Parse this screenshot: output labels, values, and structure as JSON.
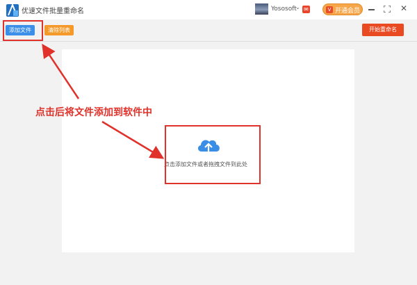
{
  "window": {
    "title": "优速文件批量重命名",
    "username": "Yososoft",
    "vip_label": "开通会员",
    "vip_icon_glyph": "V",
    "msg_glyph": "✉"
  },
  "toolbar": {
    "add_file_label": "添加文件",
    "clear_list_label": "清除列表",
    "start_rename_label": "开始重命名"
  },
  "drop_area": {
    "hint": "点击添加文件或者拖拽文件到此处",
    "icon": "cloud-upload-icon"
  },
  "annotation": {
    "text": "点击后将文件添加到软件中"
  },
  "colors": {
    "add_button": "#3b8fe8",
    "clear_button": "#f59a2a",
    "rename_button": "#ea4a22",
    "vip_button": "#f7a64a",
    "annotation_red": "#e0312a",
    "cloud_blue": "#3a8ee6"
  }
}
